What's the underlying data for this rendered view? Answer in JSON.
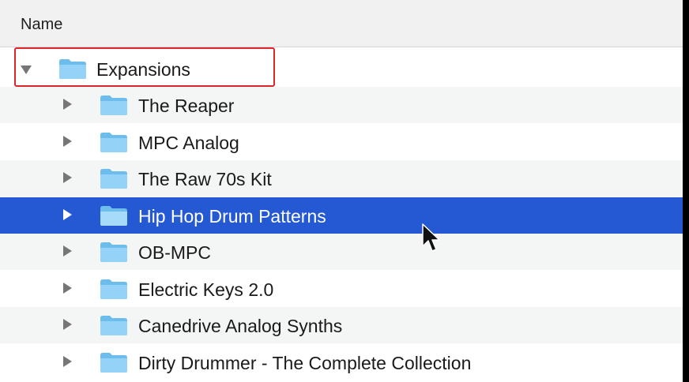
{
  "header": {
    "name_column_label": "Name"
  },
  "tree": {
    "root": {
      "label": "Expansions",
      "expanded": true,
      "icon": "folder-icon"
    },
    "children": [
      {
        "label": "The Reaper",
        "icon": "folder-icon"
      },
      {
        "label": "MPC Analog",
        "icon": "folder-icon"
      },
      {
        "label": "The Raw 70s Kit",
        "icon": "folder-icon"
      },
      {
        "label": "Hip Hop Drum Patterns",
        "icon": "folder-icon",
        "selected": true
      },
      {
        "label": "OB-MPC",
        "icon": "folder-icon"
      },
      {
        "label": "Electric Keys 2.0",
        "icon": "folder-icon"
      },
      {
        "label": "Canedrive Analog Synths",
        "icon": "folder-icon"
      },
      {
        "label": "Dirty Drummer - The Complete Collection",
        "icon": "folder-icon"
      }
    ]
  },
  "colors": {
    "selection": "#2459d3",
    "annotation_box": "#e0262b",
    "folder": "#8fd0f5"
  }
}
